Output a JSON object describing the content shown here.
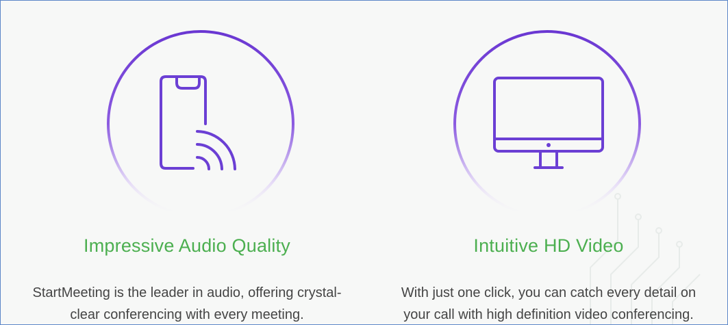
{
  "colors": {
    "accent_title": "#4caf50",
    "icon_stroke": "#6b3fd4",
    "body_text": "#444444",
    "background": "#f7f8f7"
  },
  "features": [
    {
      "icon": "phone-sound-icon",
      "title": "Impressive Audio Quality",
      "desc_line1": "StartMeeting is the leader in audio, offering crystal-",
      "desc_line2": "clear conferencing with every meeting."
    },
    {
      "icon": "monitor-icon",
      "title": "Intuitive HD Video",
      "desc_line1": "With just one click, you can catch every detail on",
      "desc_line2": "your call with high definition video conferencing."
    }
  ]
}
